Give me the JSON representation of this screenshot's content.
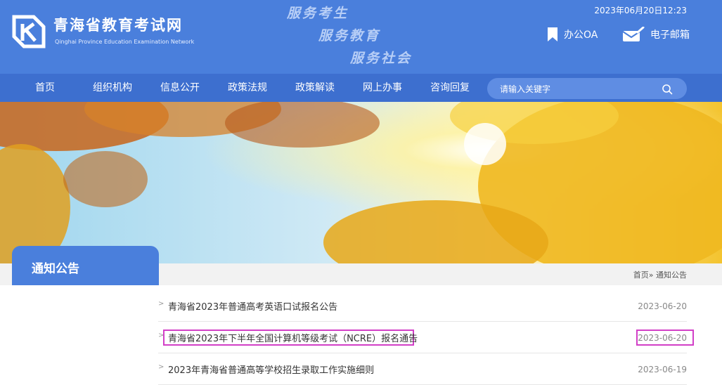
{
  "header": {
    "site_title": "青海省教育考试网",
    "site_subtitle": "Qinghai Province Education Examination Network",
    "slogans": [
      "服务考生",
      "服务教育",
      "服务社会"
    ],
    "datetime": "2023年06月20日12:23",
    "links": [
      {
        "label": "办公OA",
        "icon": "bookmark-icon"
      },
      {
        "label": "电子邮箱",
        "icon": "mail-icon"
      }
    ],
    "colors": {
      "header_bg": "#4a7fdc",
      "nav_bg": "#3d6fcf",
      "highlight": "#d23fc7"
    }
  },
  "nav": {
    "items": [
      "首页",
      "组织机构",
      "信息公开",
      "政策法规",
      "政策解读",
      "网上办事",
      "咨询回复"
    ],
    "search_placeholder": "请输入关键字"
  },
  "section": {
    "title": "通知公告",
    "breadcrumb": {
      "home": "首页",
      "separator": "»",
      "current": "通知公告"
    }
  },
  "notices": [
    {
      "title": "青海省2023年普通高考英语口试报名公告",
      "date": "2023-06-20"
    },
    {
      "title": "青海省2023年下半年全国计算机等级考试（NCRE）报名通告",
      "date": "2023-06-20"
    },
    {
      "title": "2023年青海省普通高等学校招生录取工作实施细则",
      "date": "2023-06-19"
    }
  ]
}
